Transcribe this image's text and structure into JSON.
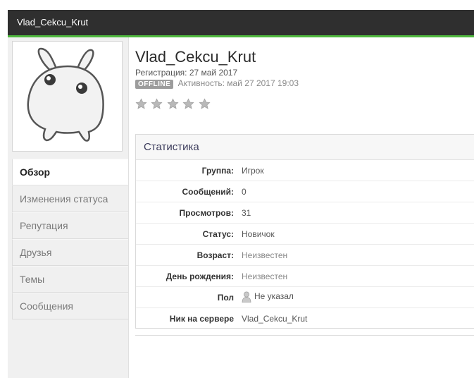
{
  "header": {
    "title": "Vlad_Cekcu_Krut"
  },
  "profile": {
    "name": "Vlad_Cekcu_Krut",
    "registration": "Регистрация: 27 май 2017",
    "status_badge": "OFFLINE",
    "activity": "Активность: май 27 2017 19:03",
    "rating": {
      "value": 0,
      "max": 5
    }
  },
  "sidebar": {
    "items": [
      {
        "label": "Обзор",
        "active": true
      },
      {
        "label": "Изменения статуса",
        "active": false
      },
      {
        "label": "Репутация",
        "active": false
      },
      {
        "label": "Друзья",
        "active": false
      },
      {
        "label": "Темы",
        "active": false
      },
      {
        "label": "Сообщения",
        "active": false
      }
    ]
  },
  "stats": {
    "title": "Статистика",
    "rows": [
      {
        "label": "Группа:",
        "value": "Игрок"
      },
      {
        "label": "Сообщений:",
        "value": "0"
      },
      {
        "label": "Просмотров:",
        "value": "31"
      },
      {
        "label": "Статус:",
        "value": "Новичок"
      },
      {
        "label": "Возраст:",
        "value": "Неизвестен"
      },
      {
        "label": "День рождения:",
        "value": "Неизвестен"
      },
      {
        "label": "Пол",
        "value": "Не указал"
      },
      {
        "label": "Ник на сервере",
        "value": "Vlad_Cekcu_Krut"
      }
    ]
  },
  "colors": {
    "accent": "#4fb83e",
    "topbar": "#2f2f2f"
  },
  "icons": {
    "gender": "person-icon",
    "rating": "star-icon"
  }
}
